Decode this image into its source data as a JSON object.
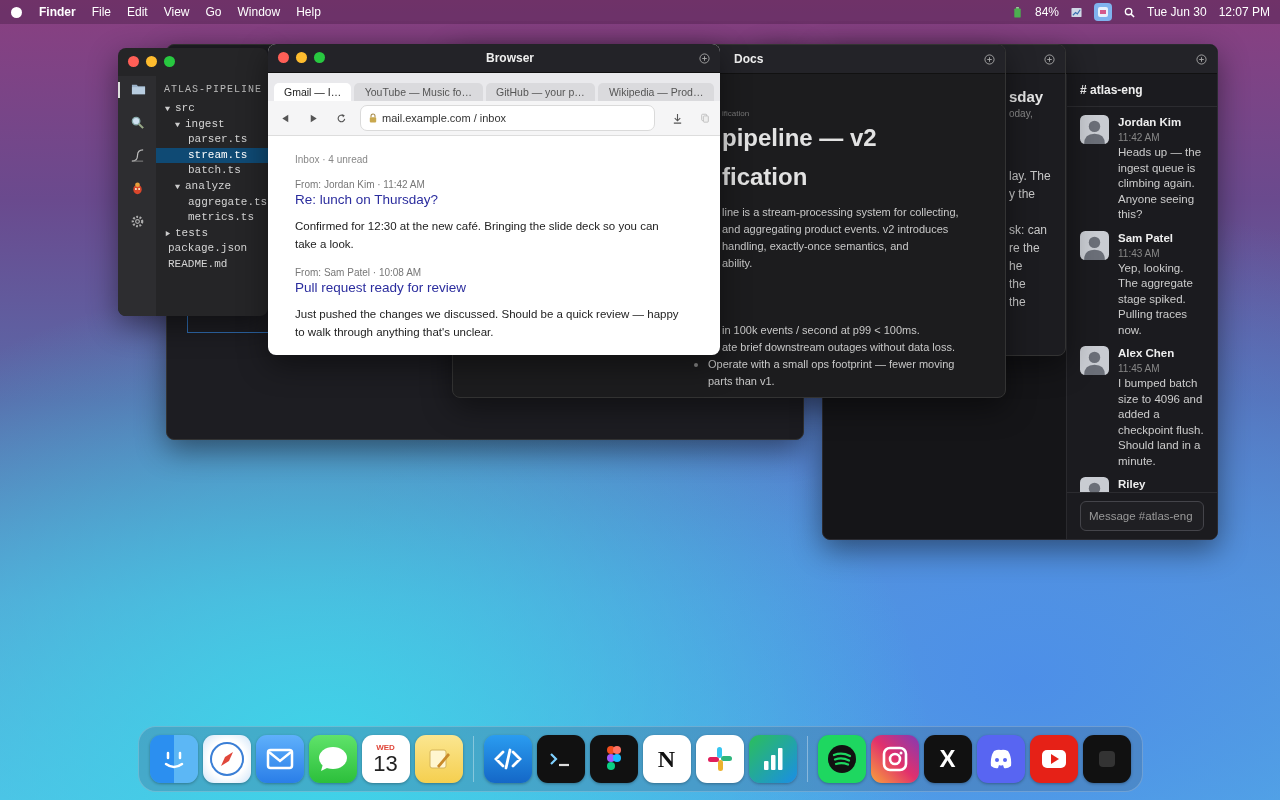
{
  "menu_bar": {
    "app": "Finder",
    "menus": [
      "File",
      "Edit",
      "View",
      "Go",
      "Window",
      "Help"
    ],
    "battery": "84%",
    "date": "Tue Jun 30",
    "time": "12:07 PM"
  },
  "explorer": {
    "title": "ATLAS-PIPELINE",
    "activity": [
      {
        "kind": "files",
        "selected": true
      },
      {
        "kind": "search",
        "selected": false
      },
      {
        "kind": "graph",
        "selected": false
      },
      {
        "kind": "debug",
        "selected": false
      },
      {
        "kind": "settings",
        "selected": false
      }
    ],
    "tree": [
      {
        "name": "src",
        "kind": "folder",
        "expanded": true,
        "selected": false,
        "children": [
          {
            "name": "ingest",
            "kind": "folder",
            "expanded": true,
            "selected": false,
            "children": [
              {
                "name": "parser.ts",
                "kind": "file",
                "selected": false
              },
              {
                "name": "stream.ts",
                "kind": "file",
                "selected": true
              },
              {
                "name": "batch.ts",
                "kind": "file",
                "selected": false
              }
            ]
          },
          {
            "name": "analyze",
            "kind": "folder",
            "expanded": true,
            "selected": false,
            "children": [
              {
                "name": "aggregate.ts",
                "kind": "file",
                "selected": false
              },
              {
                "name": "metrics.ts",
                "kind": "file",
                "selected": false
              }
            ]
          }
        ]
      },
      {
        "name": "tests",
        "kind": "folder",
        "expanded": false,
        "selected": false
      },
      {
        "name": "package.json",
        "kind": "file",
        "selected": false
      },
      {
        "name": "README.md",
        "kind": "file",
        "selected": false
      }
    ]
  },
  "browser": {
    "title": "Browser",
    "tabs": [
      {
        "label": "Gmail — I…",
        "selected": true
      },
      {
        "label": "YouTube — Music fo…",
        "selected": false
      },
      {
        "label": "GitHub — your p…",
        "selected": false
      },
      {
        "label": "Wikipedia — Prod…",
        "selected": false
      }
    ],
    "url": "mail.example.com / inbox",
    "inbox_status": "Inbox · 4 unread",
    "emails": [
      {
        "from": "From: Jordan Kim · 11:42 AM",
        "subject": "Re: lunch on Thursday?",
        "body": "Confirmed for 12:30 at the new café. Bringing the slide deck so you can take a look."
      },
      {
        "from": "From: Sam Patel · 10:08 AM",
        "subject": "Pull request ready for review",
        "body": "Just pushed the changes we discussed. Should be a quick review — happy to walk through anything that's unclear."
      }
    ]
  },
  "docs": {
    "title": "Docs",
    "breadcrumb": "ification",
    "heading_lines": [
      "pipeline — v2",
      "fication"
    ],
    "paragraph_lines": [
      "line is a stream-processing system for collecting,",
      "and aggregating product events. v2 introduces",
      "handling, exactly-once semantics, and",
      "ability."
    ],
    "partial_lines": [
      "in 100k events / second at p99 < 100ms.",
      "ate brief downstream outages without data loss."
    ],
    "bullets": [
      {
        "lines": [
          "Operate with a small ops footprint — fewer moving",
          "parts than v1."
        ]
      }
    ]
  },
  "back_window": {
    "heading": "sday",
    "subheading": "oday,",
    "paragraphs": [
      [
        "lay. The",
        "y the"
      ],
      [
        "sk: can",
        "re the",
        "he",
        "the",
        "the"
      ]
    ]
  },
  "chat": {
    "channel": "# atlas-eng",
    "messages": [
      {
        "name": "Jordan Kim",
        "time": "11:42 AM",
        "text": "Heads up — the ingest queue is climbing again. Anyone seeing this?"
      },
      {
        "name": "Sam Patel",
        "time": "11:43 AM",
        "text": "Yep, looking. The aggregate stage spiked. Pulling traces now."
      },
      {
        "name": "Alex Chen",
        "time": "11:45 AM",
        "text": "I bumped batch size to 4096 and added a checkpoint flush. Should land in a minute."
      },
      {
        "name": "Riley"
      }
    ],
    "placeholder": "Message #atlas-eng"
  },
  "dock": [
    {
      "kind": "finder"
    },
    {
      "kind": "safari"
    },
    {
      "kind": "mail"
    },
    {
      "kind": "messages"
    },
    {
      "kind": "calendar",
      "weekday": "WED",
      "day": "13"
    },
    {
      "kind": "notes"
    },
    {
      "kind": "separator"
    },
    {
      "kind": "code"
    },
    {
      "kind": "terminal"
    },
    {
      "kind": "figma"
    },
    {
      "kind": "notion",
      "letter": "N"
    },
    {
      "kind": "slack"
    },
    {
      "kind": "numbers"
    },
    {
      "kind": "separator"
    },
    {
      "kind": "spotify"
    },
    {
      "kind": "instagram"
    },
    {
      "kind": "x",
      "letter": "X"
    },
    {
      "kind": "discord"
    },
    {
      "kind": "youtube"
    },
    {
      "kind": "app"
    }
  ]
}
